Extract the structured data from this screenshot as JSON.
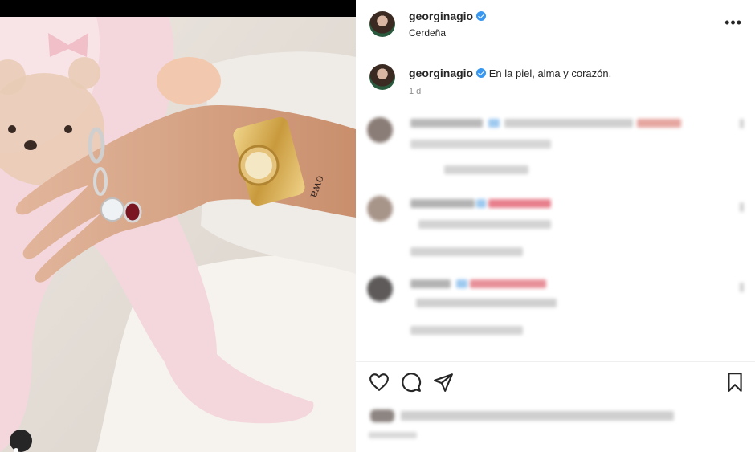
{
  "post": {
    "username": "georginagio",
    "location": "Cerdeña",
    "verified": true
  },
  "caption": {
    "username": "georginagio",
    "text": "En la piel, alma y corazón.",
    "time": "1 d"
  },
  "header": {
    "more_label": "•••"
  },
  "icons": {
    "like": "heart-icon",
    "comment": "comment-icon",
    "share": "paper-plane-icon",
    "save": "bookmark-icon",
    "more": "more-options-icon",
    "tags": "user-tag-icon"
  },
  "colors": {
    "verified": "#3897f0",
    "text": "#262626",
    "secondary_text": "#8e8e8e"
  }
}
